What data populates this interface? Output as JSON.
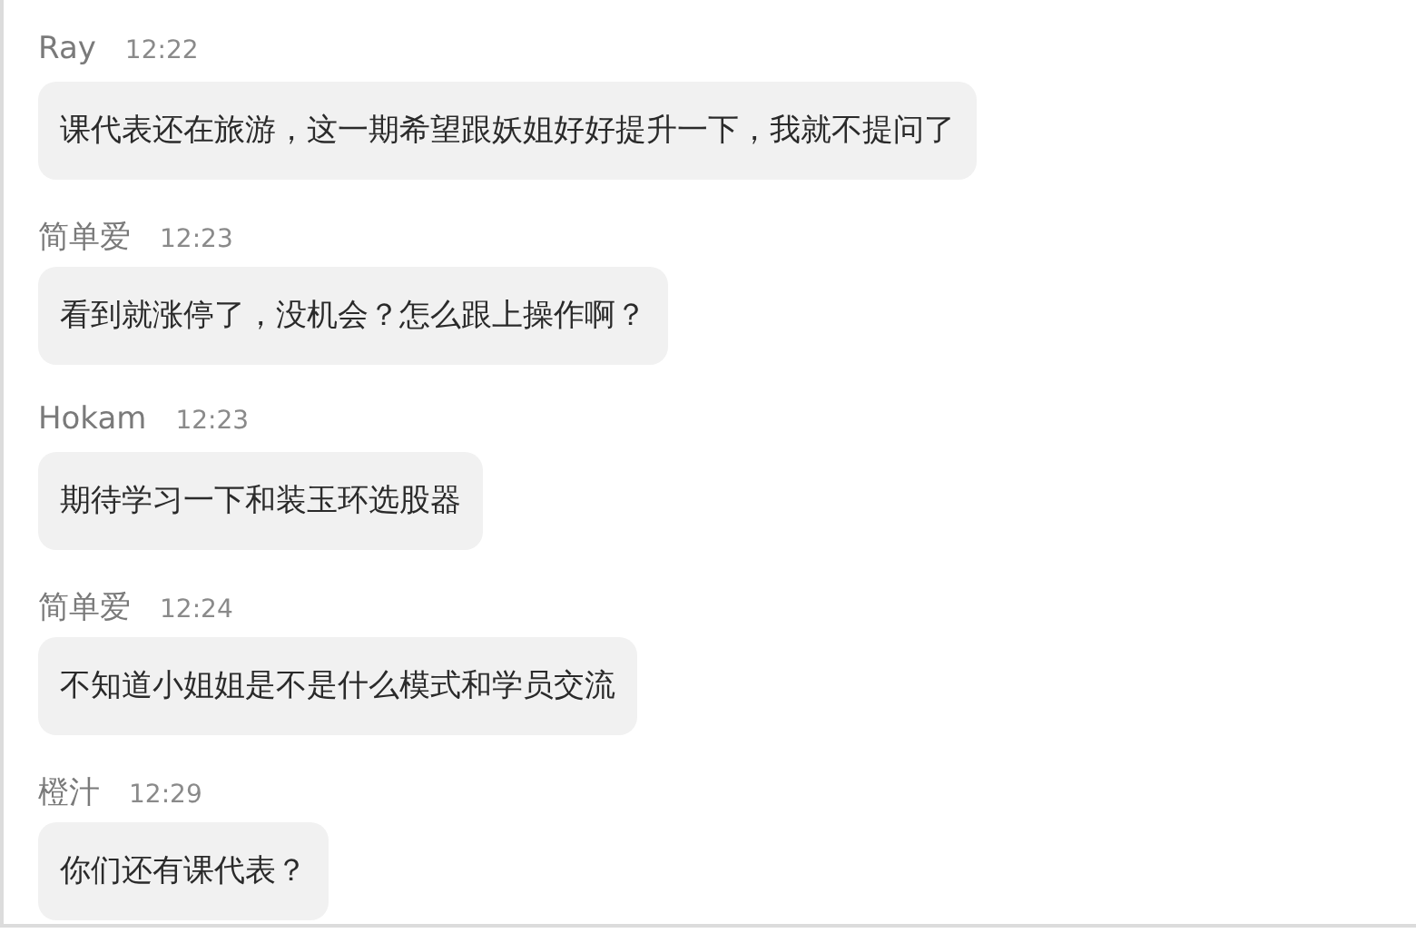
{
  "messages": [
    {
      "sender": "Ray",
      "time": "12:22",
      "text": "课代表还在旅游，这一期希望跟妖姐好好提升一下，我就不提问了"
    },
    {
      "sender": "简单爱",
      "time": "12:23",
      "text": "看到就涨停了，没机会？怎么跟上操作啊？"
    },
    {
      "sender": "Hokam",
      "time": "12:23",
      "text": "期待学习一下和装玉环选股器"
    },
    {
      "sender": "简单爱",
      "time": "12:24",
      "text": "不知道小姐姐是不是什么模式和学员交流"
    },
    {
      "sender": "橙汁",
      "time": "12:29",
      "text": "你们还有课代表？"
    }
  ]
}
